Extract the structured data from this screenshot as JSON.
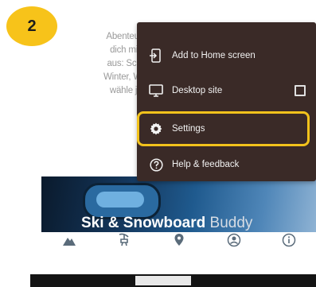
{
  "step_badge": "2",
  "background_text": [
    "Abenteuer i",
    "dich mit all",
    "aus: Schne",
    "Winter, Wan",
    "wähle jetzt"
  ],
  "menu": {
    "items": [
      {
        "label": "Add to Home screen",
        "icon": "add-to-home-icon"
      },
      {
        "label": "Desktop site",
        "icon": "desktop-icon",
        "checkbox": false
      },
      {
        "label": "Settings",
        "icon": "gear-icon",
        "highlighted": true
      },
      {
        "label": "Help & feedback",
        "icon": "help-icon"
      }
    ]
  },
  "banner": {
    "title_bold": "Ski & Snowboard",
    "title_light": "Buddy"
  },
  "bottom_nav": {
    "icons": [
      "mountain-icon",
      "ski-lift-icon",
      "location-pin-icon",
      "profile-icon",
      "info-icon"
    ]
  },
  "colors": {
    "menu_background": "#3a2a27",
    "highlight": "#f2c21c",
    "badge": "#f7c31a"
  }
}
